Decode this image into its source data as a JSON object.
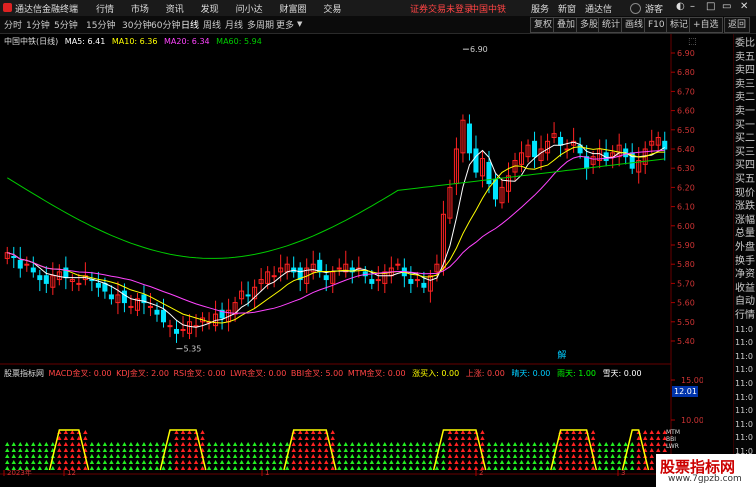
{
  "titlebar": {
    "app_title": "通达信金融终端",
    "menus": [
      "行情",
      "市场",
      "资讯",
      "发现",
      "问小达",
      "财富圈",
      "交易"
    ],
    "notice": "证券交易未登录",
    "stock": "中国中铁",
    "right_menus": [
      "服务",
      "新窗",
      "通达信"
    ],
    "guest": "游客"
  },
  "toolbar": {
    "periods": [
      "分时",
      "1分钟",
      "5分钟",
      "15分钟",
      "30分钟",
      "60分钟",
      "日线",
      "周线",
      "月线",
      "多周期",
      "更多"
    ],
    "right_buttons": [
      "复权",
      "叠加",
      "多股",
      "统计",
      "画线",
      "F10",
      "标记",
      "+自选",
      "返回"
    ]
  },
  "main_panel": {
    "symbol": "中国中铁(日线)",
    "ma": [
      {
        "label": "MA5: 6.41",
        "color": "#ffffff"
      },
      {
        "label": "MA10: 6.36",
        "color": "#ffff00"
      },
      {
        "label": "MA20: 6.34",
        "color": "#ff44ff"
      },
      {
        "label": "MA60: 5.94",
        "color": "#00cc00"
      }
    ],
    "high_marker": "6.90",
    "low_marker": "5.35",
    "tag": "解",
    "price_ticks": [
      "6.90",
      "6.80",
      "6.70",
      "6.60",
      "6.50",
      "6.40",
      "6.30",
      "6.20",
      "6.10",
      "6.00",
      "5.90",
      "5.80",
      "5.70",
      "5.60",
      "5.50",
      "5.40"
    ]
  },
  "indicator_panel": {
    "name": "股票指标网",
    "items": [
      {
        "label": "MACD金叉: 0.00",
        "color": "#ff4444"
      },
      {
        "label": "KDJ金叉: 2.00",
        "color": "#ff4444"
      },
      {
        "label": "RSI金叉: 0.00",
        "color": "#ff4444"
      },
      {
        "label": "LWR金叉: 0.00",
        "color": "#ff4444"
      },
      {
        "label": "BBI金叉: 5.00",
        "color": "#ff4444"
      },
      {
        "label": "MTM金叉: 0.00",
        "color": "#ff4444"
      },
      {
        "label": "涨买入: 0.00",
        "color": "#ffff00"
      },
      {
        "label": "上涨: 0.00",
        "color": "#ff4444"
      },
      {
        "label": "晴天: 0.00",
        "color": "#00ccff"
      },
      {
        "label": "雨天: 1.00",
        "color": "#00ff00"
      },
      {
        "label": "雪天: 0.00",
        "color": "#ffffff"
      }
    ],
    "ticks": [
      "15.00",
      "10.00",
      "5.00"
    ],
    "cursor_value": "12.01",
    "legend_words": [
      "MTM",
      "BBI",
      "LWR"
    ]
  },
  "time_axis": [
    "2023年",
    "12",
    "1",
    "2",
    "3"
  ],
  "side_panel": [
    "委比",
    "卖五",
    "卖四",
    "卖三",
    "卖二",
    "卖一",
    "买一",
    "买二",
    "买三",
    "买四",
    "买五",
    "现价",
    "涨跌",
    "涨幅",
    "总量",
    "外盘",
    "换手",
    "净资",
    "收益",
    "自动",
    "行情",
    "11:0",
    "11:0",
    "11:0",
    "11:0",
    "11:0",
    "11:0",
    "11:0",
    "11:0",
    "11:0",
    "11:0",
    "11:0"
  ],
  "watermark": {
    "title": "股票指标网",
    "url": "www.7gpzb.com"
  },
  "colors": {
    "up": "#ff2222",
    "down": "#00e5ff",
    "ma5": "#ffffff",
    "ma10": "#ffff00",
    "ma20": "#ff44ff",
    "ma60": "#00cc00"
  }
}
